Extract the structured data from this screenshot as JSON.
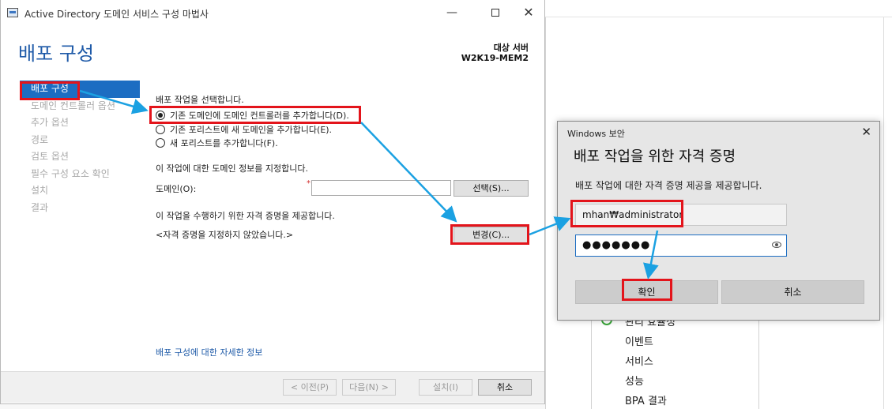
{
  "wizard": {
    "window_title": "Active Directory 도메인 서비스 구성 마법사",
    "page_title": "배포 구성",
    "target_label": "대상 서버",
    "target_name": "W2K19-MEM2",
    "nav": [
      {
        "label": "배포 구성"
      },
      {
        "label": "도메인 컨트롤러 옵션"
      },
      {
        "label": "추가 옵션"
      },
      {
        "label": "경로"
      },
      {
        "label": "검토 옵션"
      },
      {
        "label": "필수 구성 요소 확인"
      },
      {
        "label": "설치"
      },
      {
        "label": "결과"
      }
    ],
    "select_operation": "배포 작업을 선택합니다.",
    "options": [
      {
        "label": "기존 도메인에 도메인 컨트롤러를 추가합니다(D).",
        "checked": true
      },
      {
        "label": "기존 포리스트에 새 도메인을 추가합니다(E).",
        "checked": false
      },
      {
        "label": "새 포리스트를 추가합니다(F).",
        "checked": false
      }
    ],
    "domain_info_label": "이 작업에 대한 도메인 정보를 지정합니다.",
    "domain_label": "도메인(O):",
    "domain_value": "",
    "required_mark": "*",
    "select_button": "선택(S)...",
    "credentials_label": "이 작업을 수행하기 위한 자격 증명을 제공합니다.",
    "credentials_status": "<자격 증명을 지정하지 않았습니다.>",
    "change_button": "변경(C)...",
    "more_info_link": "배포 구성에 대한 자세한 정보",
    "footer": {
      "prev": "< 이전(P)",
      "next": "다음(N) >",
      "install": "설치(I)",
      "cancel": "취소"
    }
  },
  "credential_dialog": {
    "window_title": "Windows 보안",
    "title": "배포 작업을 위한 자격 증명",
    "description": "배포 작업에 대한 자격 증명 제공을 제공합니다.",
    "username": "mhan₩administrator",
    "password_mask": "●●●●●●●",
    "ok_button": "확인",
    "cancel_button": "취소"
  },
  "background_panel": {
    "items": [
      "관리 효율성",
      "이벤트",
      "서비스",
      "성능",
      "BPA 결과"
    ],
    "bottom_labels": [
      "BPA 결과",
      "BPA 결과",
      "BPA 결과"
    ]
  },
  "colors": {
    "highlight": "#e3141b",
    "arrow": "#1ba1e2",
    "nav_active": "#1c6dc2",
    "title_blue": "#1e5aa8"
  }
}
